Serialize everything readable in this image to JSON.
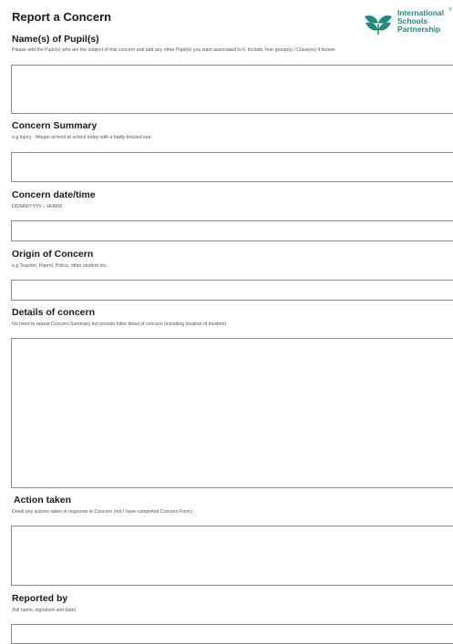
{
  "form_title": "Report a Concern",
  "logo": {
    "line1": "International",
    "line2": "Schools",
    "line3": "Partnership",
    "tm": "®",
    "color": "#1f8a7d"
  },
  "sections": [
    {
      "title": "Name(s) of Pupil(s)",
      "hint": "Please add the Pupil(s) who are the subject of this concern and add any other Pupil(s) you want associated to it, Include Year group(s) / Class(es) if known"
    },
    {
      "title": "Concern Summary",
      "hint": "e.g Injury -  Megan arrived at school today with a badly bruised eye."
    },
    {
      "title": "Concern date/time",
      "hint": "DD/MM/YYYY – HHMM"
    },
    {
      "title": "Origin of Concern",
      "hint": "e.g Teacher, Parent, Police, other student etc."
    },
    {
      "title": "Details of concern",
      "hint": "No need to repeat Concern Summary but provide fuller detail of concern (including location of incident)."
    },
    {
      "title": "Action taken",
      "hint": "Detail any actions taken in response to Concern (not I have completed Concern Form)."
    },
    {
      "title": "Reported by",
      "hint": "(full name, signature and date)"
    }
  ]
}
